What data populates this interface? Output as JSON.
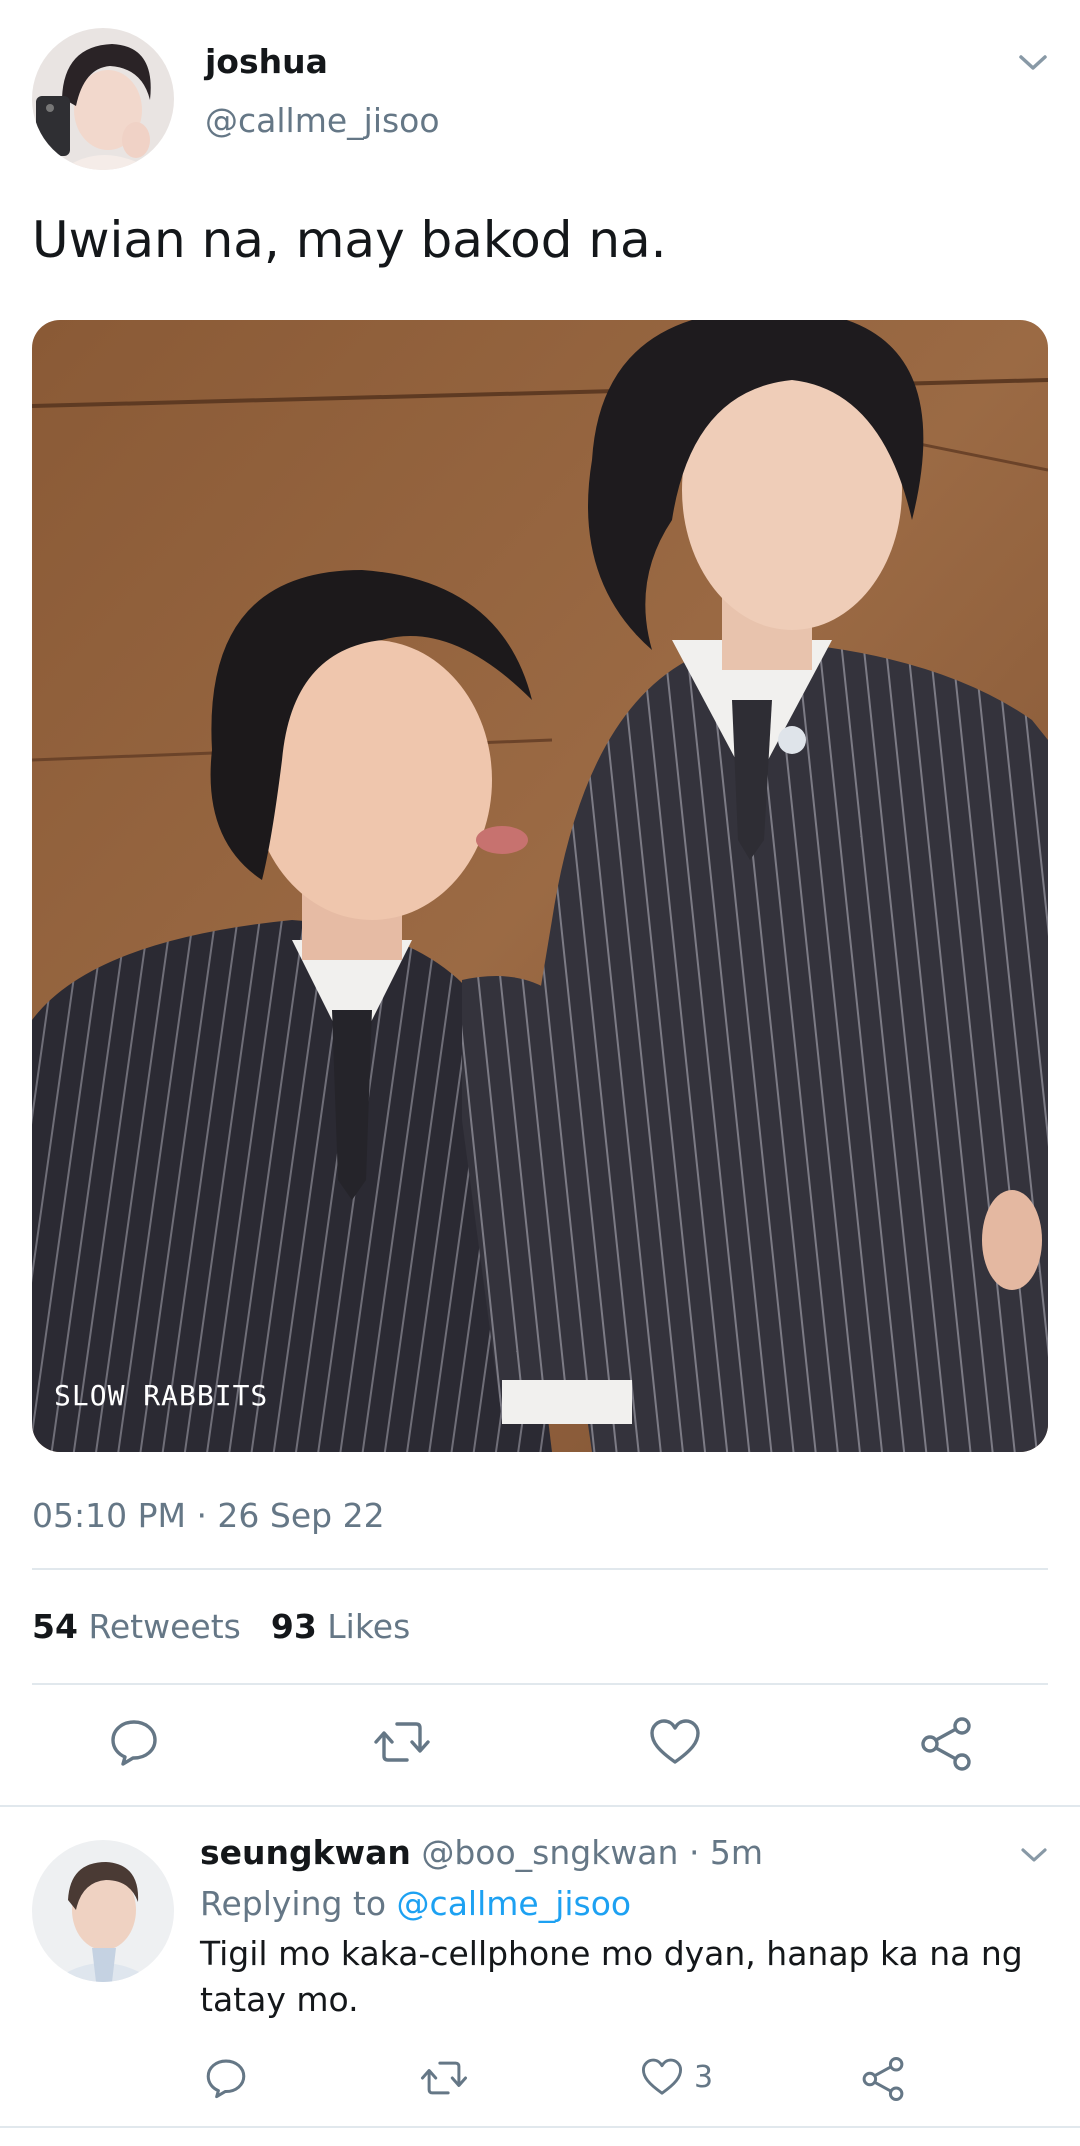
{
  "tweet": {
    "author_name": "joshua",
    "author_handle": "@callme_jisoo",
    "text": "Uwian na, may bakod na.",
    "media_watermark": "SLOW RABBITS",
    "timestamp": "05:10 PM · 26 Sep 22",
    "retweets_count": "54",
    "retweets_label": "Retweets",
    "likes_count": "93",
    "likes_label": "Likes"
  },
  "reply": {
    "author_name": "seungkwan",
    "author_meta": "@boo_sngkwan · 5m",
    "replying_prefix": "Replying to",
    "replying_to": "@callme_jisoo",
    "text": "Tigil mo kaka-cellphone mo dyan, hanap ka na ng tatay mo.",
    "like_count": "3"
  },
  "icons": {
    "reply": "reply-icon",
    "retweet": "retweet-icon",
    "like": "heart-icon",
    "share": "share-icon",
    "caret": "chevron-down-icon"
  },
  "colors": {
    "secondary_text": "#657786",
    "link": "#1da1f2",
    "divider": "#e1e8ed"
  }
}
